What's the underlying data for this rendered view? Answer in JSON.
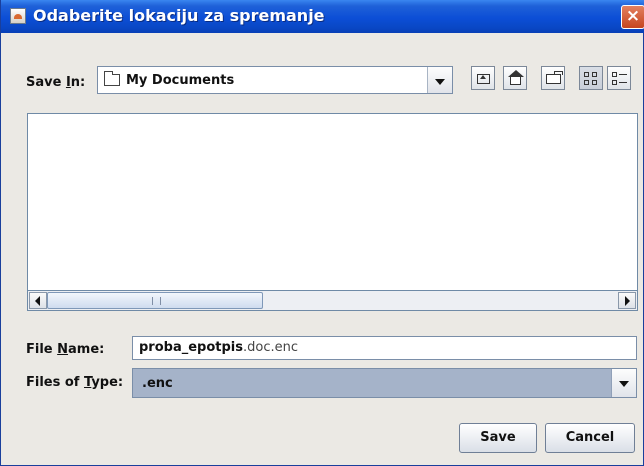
{
  "window": {
    "title": "Odaberite lokaciju za spremanje",
    "close_glyph": "×"
  },
  "save_in": {
    "label_pre": "Save ",
    "label_mnemonic": "I",
    "label_post": "n:",
    "value": "My Documents",
    "folder_icon": "folder-icon"
  },
  "toolbar": {
    "buttons": [
      {
        "name": "up-one-level-button",
        "icon": "up-folder-icon"
      },
      {
        "name": "home-button",
        "icon": "home-icon"
      },
      {
        "name": "new-folder-button",
        "icon": "new-folder-icon"
      },
      {
        "name": "list-view-button",
        "icon": "list-view-icon",
        "pressed": true
      },
      {
        "name": "details-view-button",
        "icon": "details-view-icon"
      }
    ]
  },
  "file_list": {
    "items": []
  },
  "file_name": {
    "label_pre": "File ",
    "label_mnemonic": "N",
    "label_post": "ame:",
    "value_base": "proba_epotpis",
    "value_ext": ".doc.enc"
  },
  "files_of_type": {
    "label_pre": "Files of ",
    "label_mnemonic": "T",
    "label_post": "ype:",
    "value": ".enc"
  },
  "buttons": {
    "save": "Save",
    "cancel": "Cancel"
  },
  "colors": {
    "title_bar": "#0c4ed6",
    "dialog_bg": "#ebe9e4",
    "selection": "#a5b3c9",
    "close": "#c64520"
  }
}
